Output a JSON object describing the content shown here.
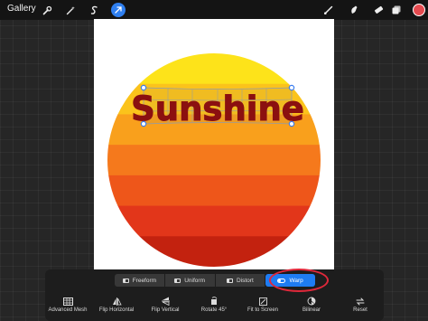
{
  "topbar": {
    "gallery_label": "Gallery",
    "left_tools": [
      "wrench-icon",
      "magic-wand-icon",
      "selection-s-icon",
      "transform-arrow-icon"
    ],
    "right_tools": [
      "brush-icon",
      "smudge-icon",
      "eraser-icon",
      "layers-icon"
    ],
    "active_tool": "transform-arrow-icon",
    "current_color": "#e44a4f"
  },
  "canvas": {
    "artwork_text": "Sunshine",
    "text_color": "#8b1010",
    "stripe_colors": [
      "#fde31a",
      "#fbc31b",
      "#f9a01c",
      "#f5791c",
      "#ee561a",
      "#e2361a",
      "#c3220f"
    ]
  },
  "warp_toolbar": {
    "modes": [
      {
        "label": "Freeform"
      },
      {
        "label": "Uniform"
      },
      {
        "label": "Distort"
      },
      {
        "label": "Warp"
      }
    ],
    "selected_mode": "Warp",
    "actions": [
      {
        "label": "Advanced Mesh",
        "icon": "mesh-grid-icon"
      },
      {
        "label": "Flip Horizontal",
        "icon": "flip-horizontal-icon"
      },
      {
        "label": "Flip Vertical",
        "icon": "flip-vertical-icon"
      },
      {
        "label": "Rotate 45°",
        "icon": "rotate-icon"
      },
      {
        "label": "Fit to Screen",
        "icon": "fit-screen-icon"
      },
      {
        "label": "Bilinear",
        "icon": "bilinear-icon"
      },
      {
        "label": "Reset",
        "icon": "reset-icon"
      }
    ]
  }
}
